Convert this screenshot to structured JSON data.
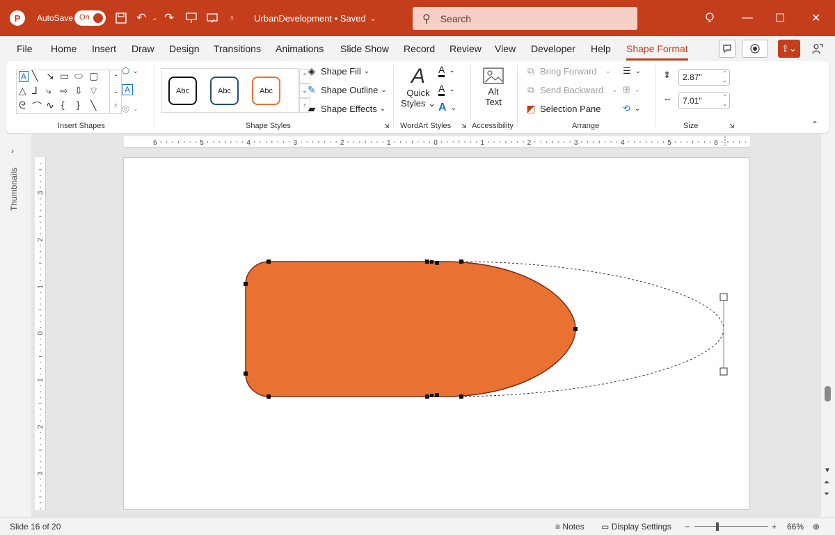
{
  "titlebar": {
    "autosave_label": "AutoSave",
    "toggle_state": "On",
    "filename": "UrbanDevelopment • Saved",
    "search_placeholder": "Search",
    "accent": "#c43e1c"
  },
  "tabs": [
    "File",
    "Home",
    "Insert",
    "Draw",
    "Design",
    "Transitions",
    "Animations",
    "Slide Show",
    "Record",
    "Review",
    "View",
    "Developer",
    "Help",
    "Shape Format"
  ],
  "active_tab": "Shape Format",
  "ribbon": {
    "insert_shapes_label": "Insert Shapes",
    "style_samples": [
      "Abc",
      "Abc",
      "Abc"
    ],
    "shape_fill": "Shape Fill",
    "shape_outline": "Shape Outline",
    "shape_effects": "Shape Effects",
    "shape_styles_label": "Shape Styles",
    "quick_styles_1": "Quick",
    "quick_styles_2": "Styles",
    "wordart_label": "WordArt Styles",
    "alt_text_1": "Alt",
    "alt_text_2": "Text",
    "accessibility_label": "Accessibility",
    "bring_forward": "Bring Forward",
    "send_backward": "Send Backward",
    "selection_pane": "Selection Pane",
    "arrange_label": "Arrange",
    "height_value": "2.87\"",
    "width_value": "7.01\"",
    "size_label": "Size"
  },
  "thumbnails_label": "Thumbnails",
  "hruler_labels": [
    "6",
    "5",
    "4",
    "3",
    "2",
    "1",
    "0",
    "1",
    "2",
    "3",
    "4",
    "5",
    "6"
  ],
  "vruler_labels": [
    "3",
    "2",
    "1",
    "0",
    "1",
    "2",
    "3"
  ],
  "shape": {
    "fill": "#e97132",
    "outline": "#7a2a12"
  },
  "statusbar": {
    "slide_info": "Slide 16 of 20",
    "notes": "Notes",
    "display_settings": "Display Settings",
    "zoom": "66%"
  }
}
